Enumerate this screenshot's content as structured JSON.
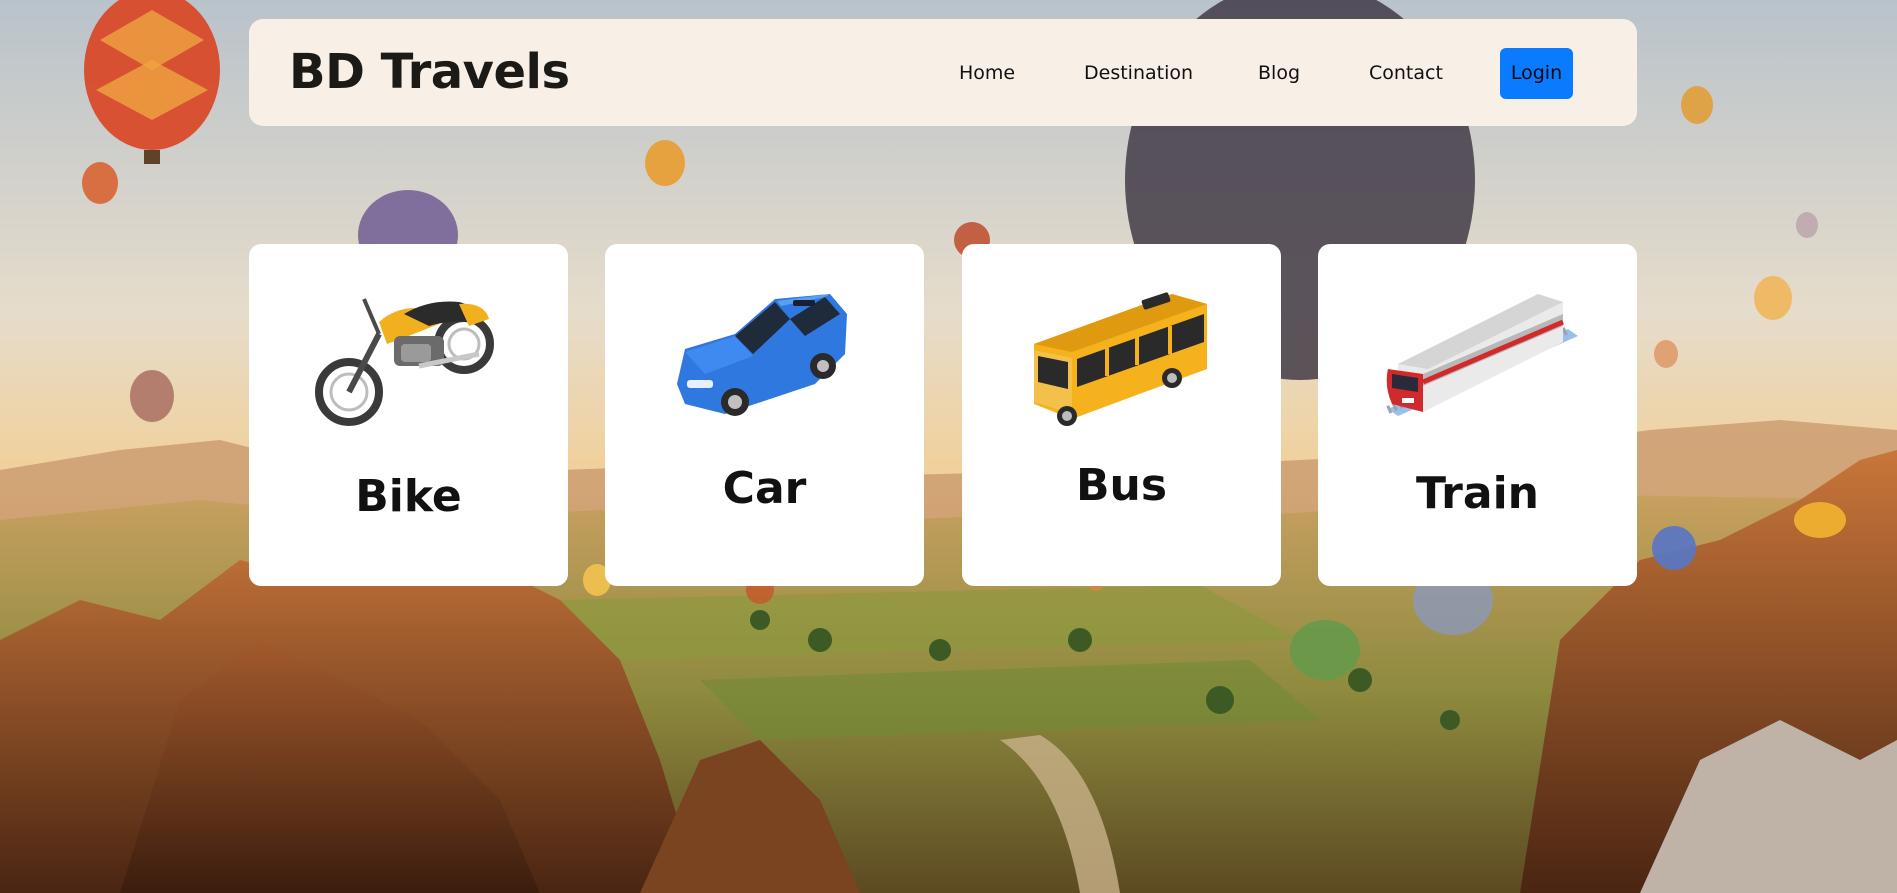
{
  "brand": {
    "name": "BD Travels"
  },
  "nav": {
    "items": [
      {
        "label": "Home"
      },
      {
        "label": "Destination"
      },
      {
        "label": "Blog"
      },
      {
        "label": "Contact"
      }
    ],
    "login_label": "Login"
  },
  "cards": [
    {
      "label": "Bike",
      "icon": "motorcycle-icon"
    },
    {
      "label": "Car",
      "icon": "car-icon"
    },
    {
      "label": "Bus",
      "icon": "bus-icon"
    },
    {
      "label": "Train",
      "icon": "train-icon"
    }
  ],
  "colors": {
    "navbar_bg": "#f8efe6",
    "login_bg": "#0a7aff",
    "card_bg": "#ffffff"
  }
}
